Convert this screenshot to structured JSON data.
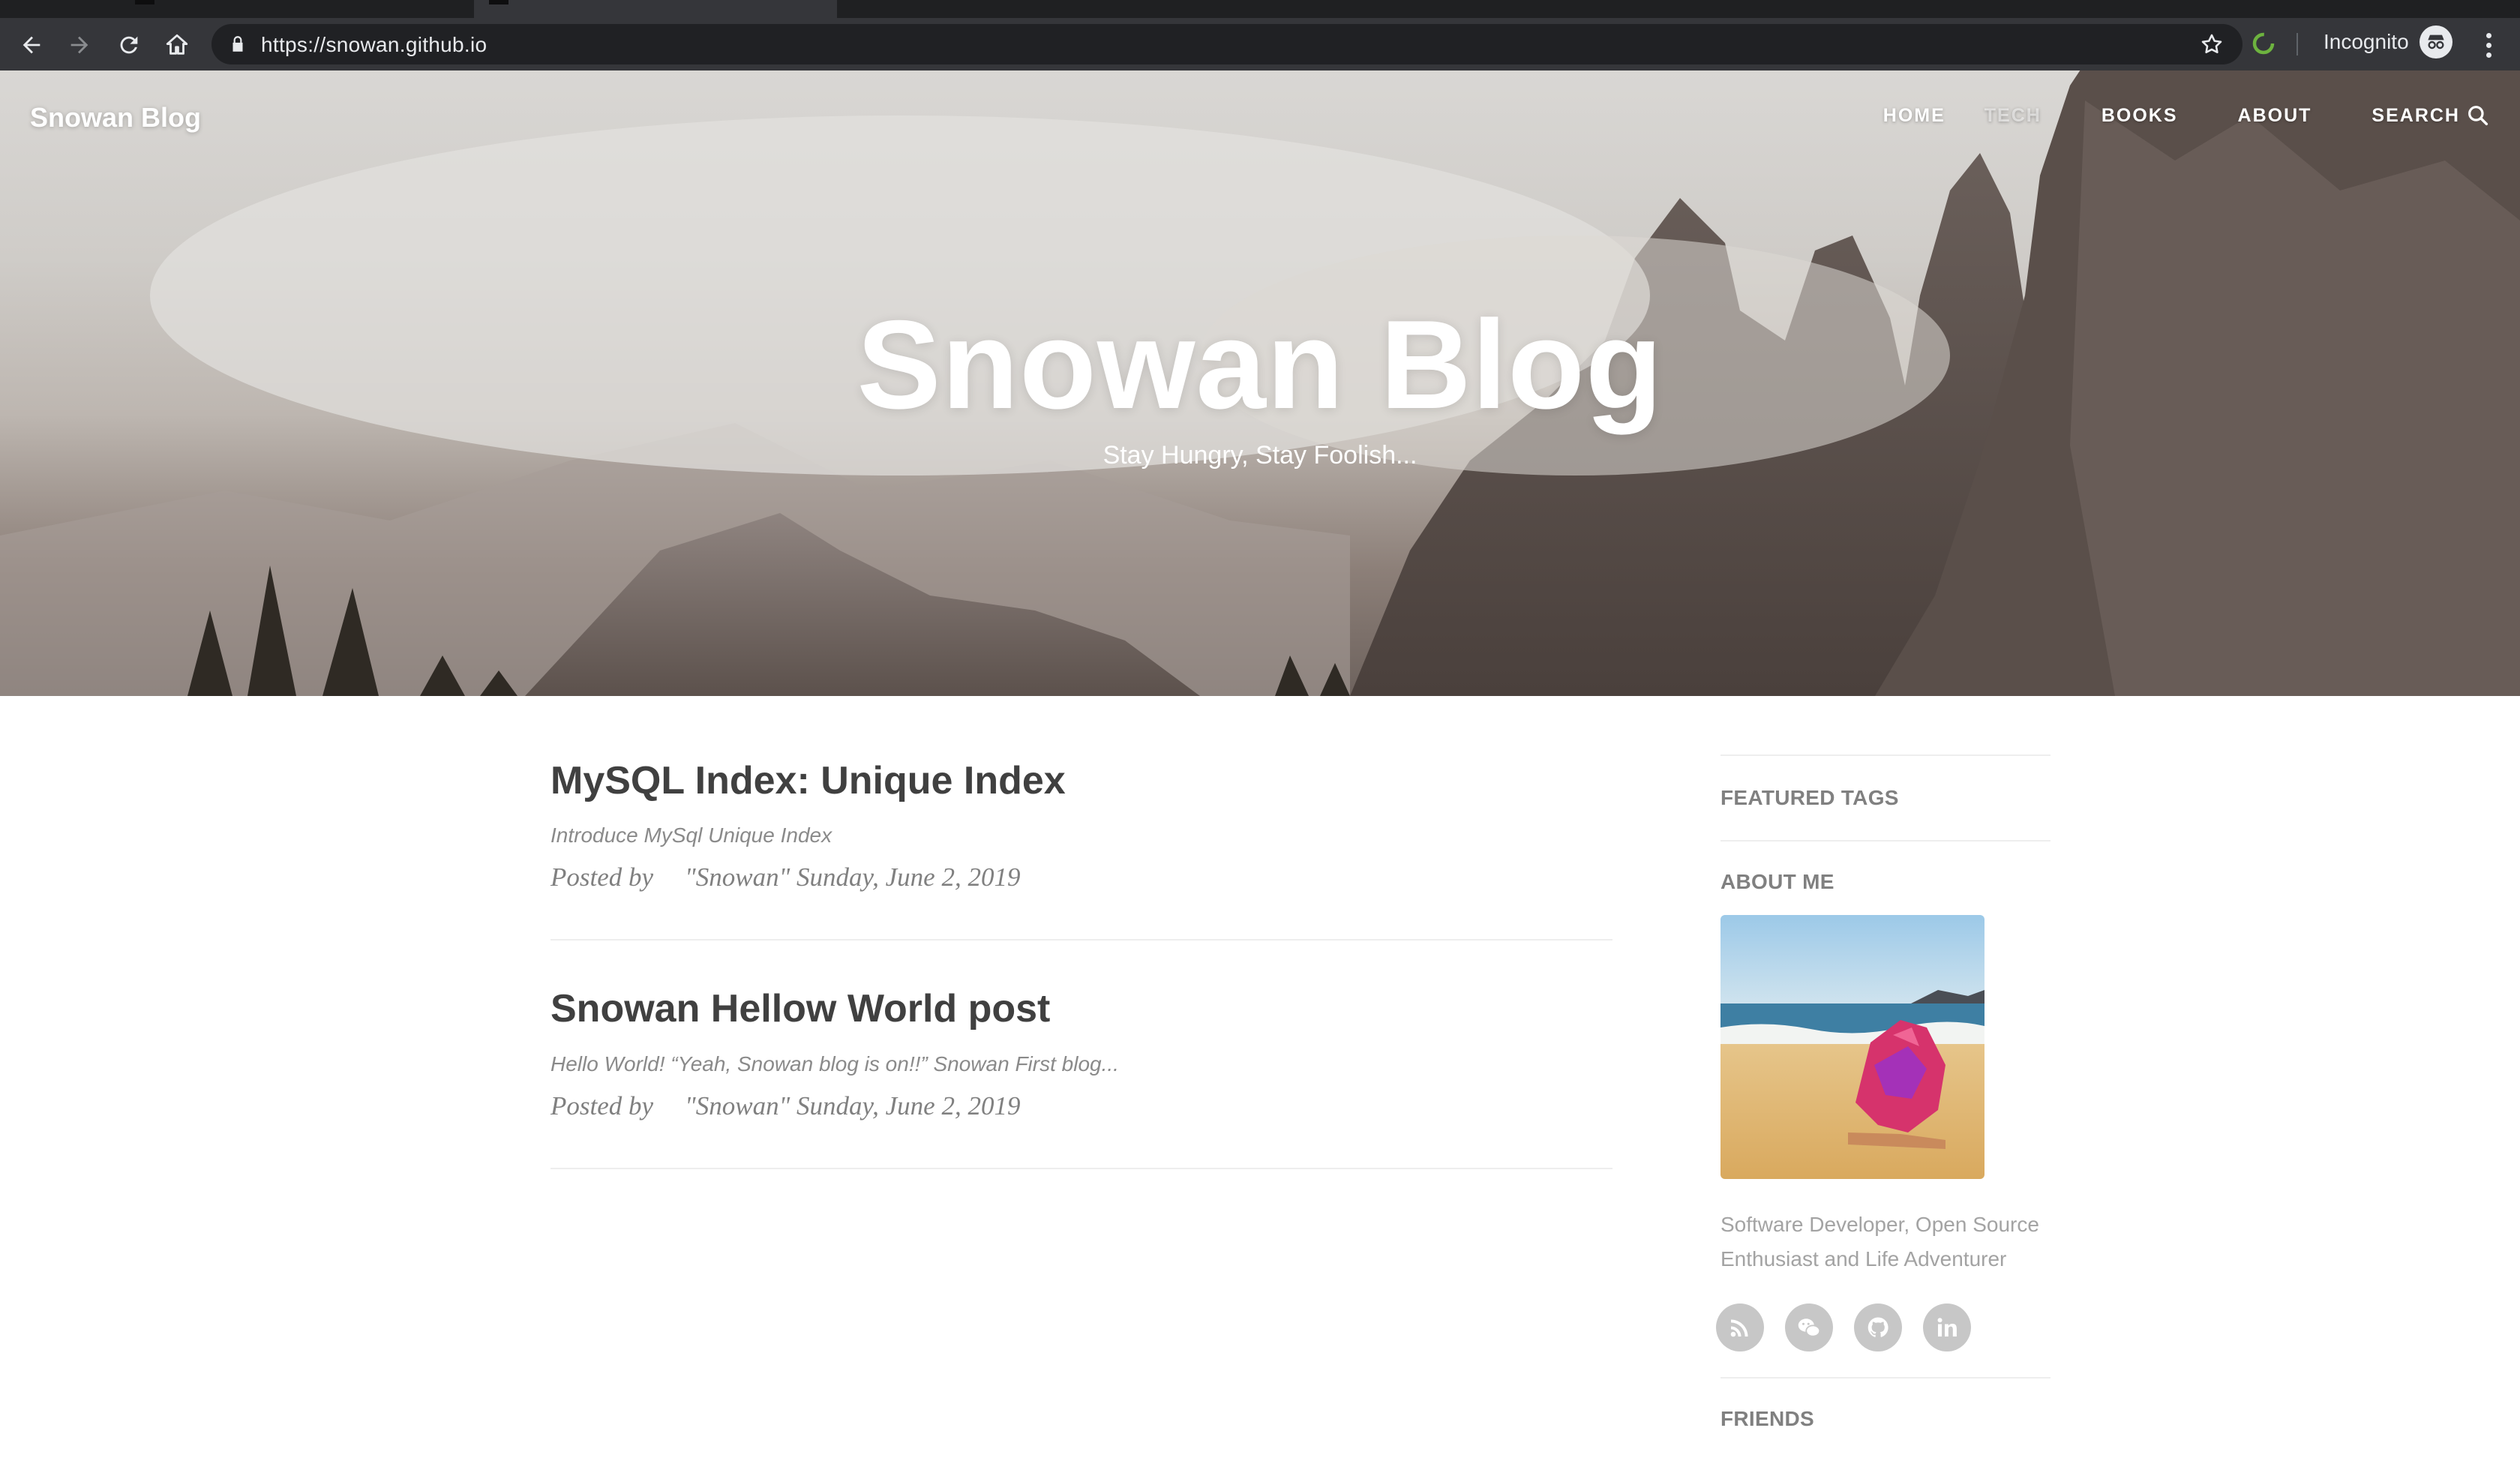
{
  "browser": {
    "url": "https://snowan.github.io",
    "profile_label": "Incognito"
  },
  "header": {
    "brand": "Snowan Blog",
    "nav": [
      {
        "label": "HOME"
      },
      {
        "label": "TECH"
      },
      {
        "label": "BOOKS"
      },
      {
        "label": "ABOUT"
      },
      {
        "label": "SEARCH",
        "icon": "search-icon"
      }
    ]
  },
  "hero": {
    "title": "Snowan Blog",
    "subtitle": "Stay Hungry, Stay Foolish..."
  },
  "posts": [
    {
      "title": "MySQL Index: Unique Index",
      "subtitle": "Introduce MySql Unique Index",
      "posted_by": "Posted by",
      "author": "\"Snowan\"",
      "date": "Sunday, June 2, 2019"
    },
    {
      "title": "Snowan Hellow World post",
      "subtitle": "Hello World! “Yeah, Snowan blog is on!!” Snowan First blog...",
      "posted_by": "Posted by",
      "author": "\"Snowan\"",
      "date": "Sunday, June 2, 2019"
    }
  ],
  "sidebar": {
    "featured_tags": "FEATURED TAGS",
    "about_me": "ABOUT ME",
    "bio": "Software Developer, Open Source Enthusiast and Life Adventurer",
    "socials": [
      "rss-icon",
      "wechat-icon",
      "github-icon",
      "linkedin-icon"
    ],
    "friends": "FRIENDS"
  },
  "colors": {
    "chrome_bg": "#35363a",
    "omnibox_bg": "#202124",
    "title_text": "#404040",
    "meta_text": "#808080",
    "social_bg": "#c7c7c7"
  }
}
